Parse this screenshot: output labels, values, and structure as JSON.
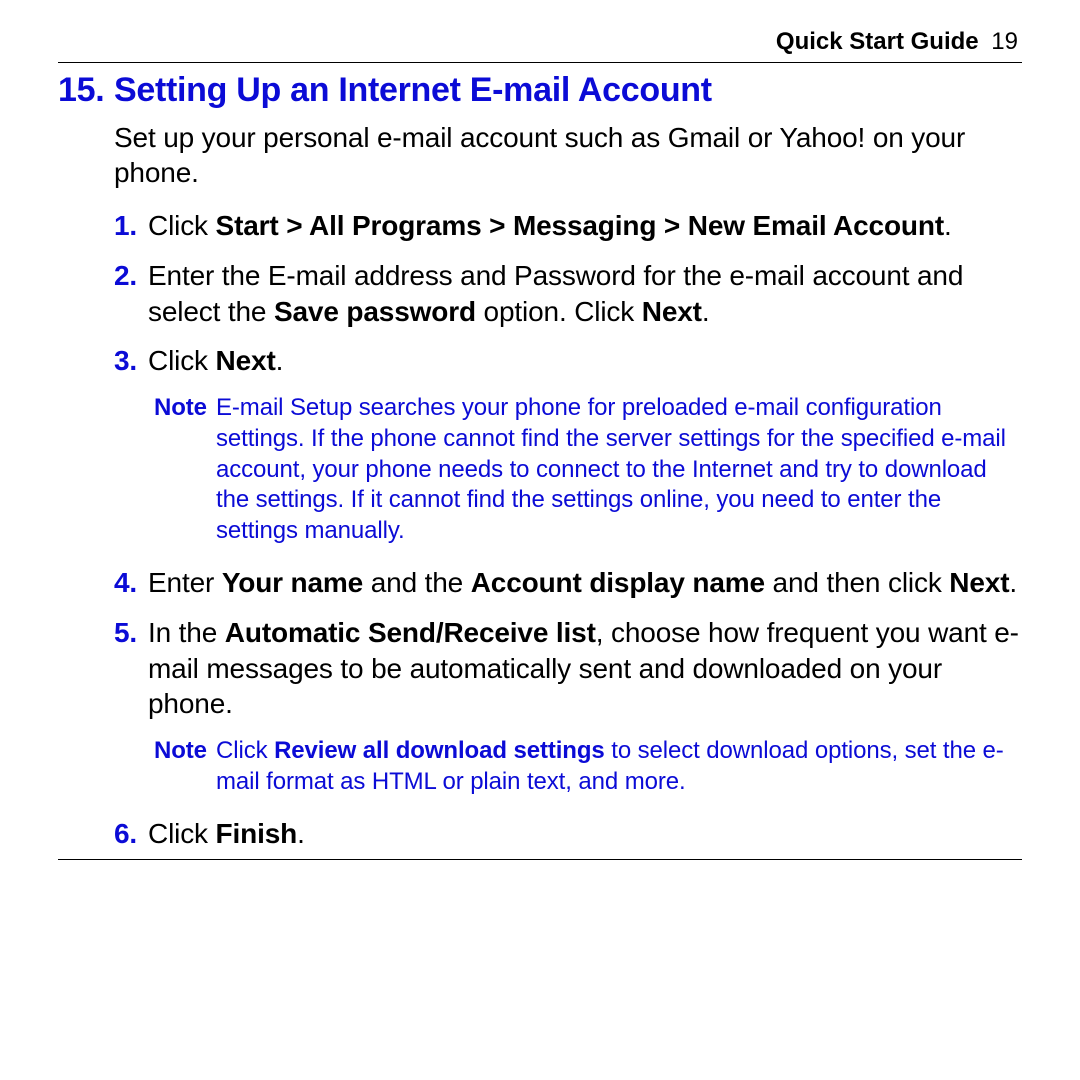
{
  "header": {
    "guide_label": "Quick Start Guide",
    "page_number": "19"
  },
  "section": {
    "number": "15.",
    "title": "Setting Up an Internet E-mail Account"
  },
  "intro": "Set up your personal e-mail account such as Gmail or Yahoo! on your phone.",
  "steps": {
    "s1": {
      "num": "1.",
      "prefix": "Click ",
      "bold": "Start > All Programs > Messaging > New Email Account",
      "suffix": "."
    },
    "s2": {
      "num": "2.",
      "part1": "Enter the E-mail address and Password for the e-mail account and select the ",
      "bold1": "Save password",
      "part2": " option. Click ",
      "bold2": "Next",
      "part3": "."
    },
    "s3": {
      "num": "3.",
      "prefix": "Click ",
      "bold": "Next",
      "suffix": "."
    },
    "s4": {
      "num": "4.",
      "part1": "Enter ",
      "bold1": "Your name",
      "part2": " and the ",
      "bold2": "Account display name",
      "part3": " and then click ",
      "bold3": "Next",
      "part4": "."
    },
    "s5": {
      "num": "5.",
      "part1": "In the ",
      "bold1": "Automatic Send/Receive list",
      "part2": ", choose how frequent you want e-mail messages to be automatically sent and downloaded on your phone."
    },
    "s6": {
      "num": "6.",
      "prefix": "Click ",
      "bold": "Finish",
      "suffix": "."
    }
  },
  "notes": {
    "n1": {
      "label": "Note",
      "body": "E-mail Setup searches your phone for preloaded e-mail configuration settings. If the phone cannot find the server settings for the specified e-mail account, your phone needs to connect to the Internet and try to download the settings. If it cannot find the settings online, you need to enter the settings manually."
    },
    "n2": {
      "label": "Note",
      "part1": "Click ",
      "bold1": "Review all download settings",
      "part2": " to select download options, set the e-mail format as HTML or plain text, and more."
    }
  }
}
